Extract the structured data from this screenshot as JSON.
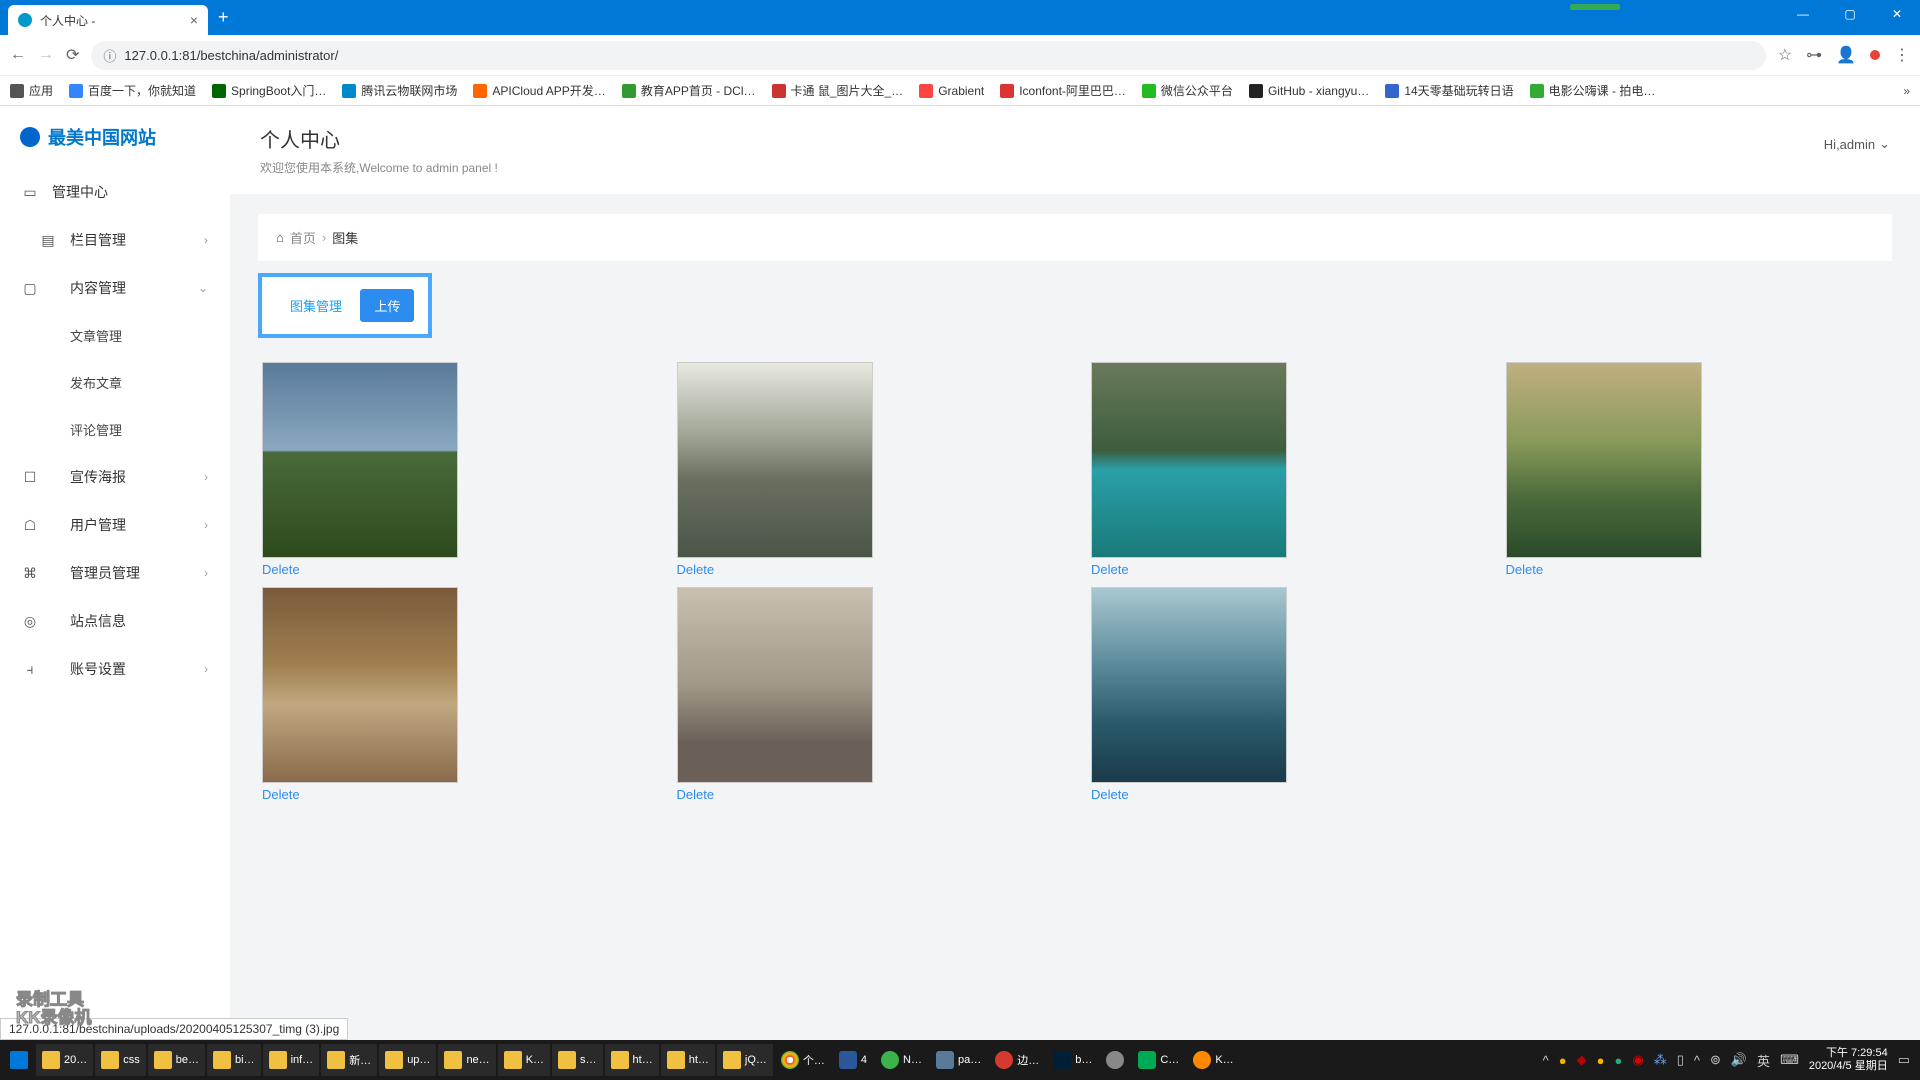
{
  "browser": {
    "tab_title": "个人中心 -",
    "url": "127.0.0.1:81/bestchina/administrator/",
    "apps_label": "应用",
    "bookmarks": [
      "百度一下，你就知道",
      "SpringBoot入门…",
      "腾讯云物联网市场",
      "APICloud APP开发…",
      "教育APP首页 - DCl…",
      "卡通 鼠_图片大全_…",
      "Grabient",
      "Iconfont-阿里巴巴…",
      "微信公众平台",
      "GitHub - xiangyu…",
      "14天零基础玩转日语",
      "电影公嗨课 - 拍电…"
    ]
  },
  "logo": "最美中国网站",
  "sidebar": {
    "items": [
      {
        "label": "管理中心",
        "icon": "⌨",
        "expandable": false
      },
      {
        "label": "栏目管理",
        "icon": "▤",
        "expandable": true
      },
      {
        "label": "内容管理",
        "icon": "▢",
        "expandable": true,
        "expanded": true
      },
      {
        "label": "宣传海报",
        "icon": "☐",
        "expandable": true
      },
      {
        "label": "用户管理",
        "icon": "☖",
        "expandable": true
      },
      {
        "label": "管理员管理",
        "icon": "⌘",
        "expandable": true
      },
      {
        "label": "站点信息",
        "icon": "◎",
        "expandable": false
      },
      {
        "label": "账号设置",
        "icon": "⫞",
        "expandable": true
      }
    ],
    "sub_content": {
      "articles": "文章管理",
      "publish": "发布文章",
      "comments": "评论管理"
    }
  },
  "header": {
    "title": "个人中心",
    "subtitle": "欢迎您使用本系统,Welcome to admin panel !",
    "user": "Hi,admin"
  },
  "breadcrumb": {
    "home": "首页",
    "current": "图集"
  },
  "tabs": {
    "manage": "图集管理",
    "upload": "上传"
  },
  "gallery": {
    "delete_label": "Delete",
    "items": [
      {
        "style": "s1"
      },
      {
        "style": "s2"
      },
      {
        "style": "s3"
      },
      {
        "style": "s4"
      },
      {
        "style": "s5"
      },
      {
        "style": "s6"
      },
      {
        "style": "s7"
      }
    ]
  },
  "status_bar": "127.0.0.1:81/bestchina/uploads/20200405125307_timg (3).jpg",
  "watermark": {
    "line1": "录制工具",
    "line2": "KK录像机"
  },
  "taskbar": {
    "folders": [
      "20…",
      "css",
      "be…",
      "bi…",
      "inf…",
      "新…",
      "up…",
      "ne…",
      "K…",
      "s…",
      "ht…",
      "ht…",
      "jQ…"
    ],
    "apps": [
      "个…",
      "4",
      "N…",
      "pa…",
      "边…",
      "b…",
      "",
      "C…",
      "K…"
    ],
    "clock": {
      "time": "下午 7:29:54",
      "date": "2020/4/5 星期日"
    },
    "ime": "英"
  }
}
